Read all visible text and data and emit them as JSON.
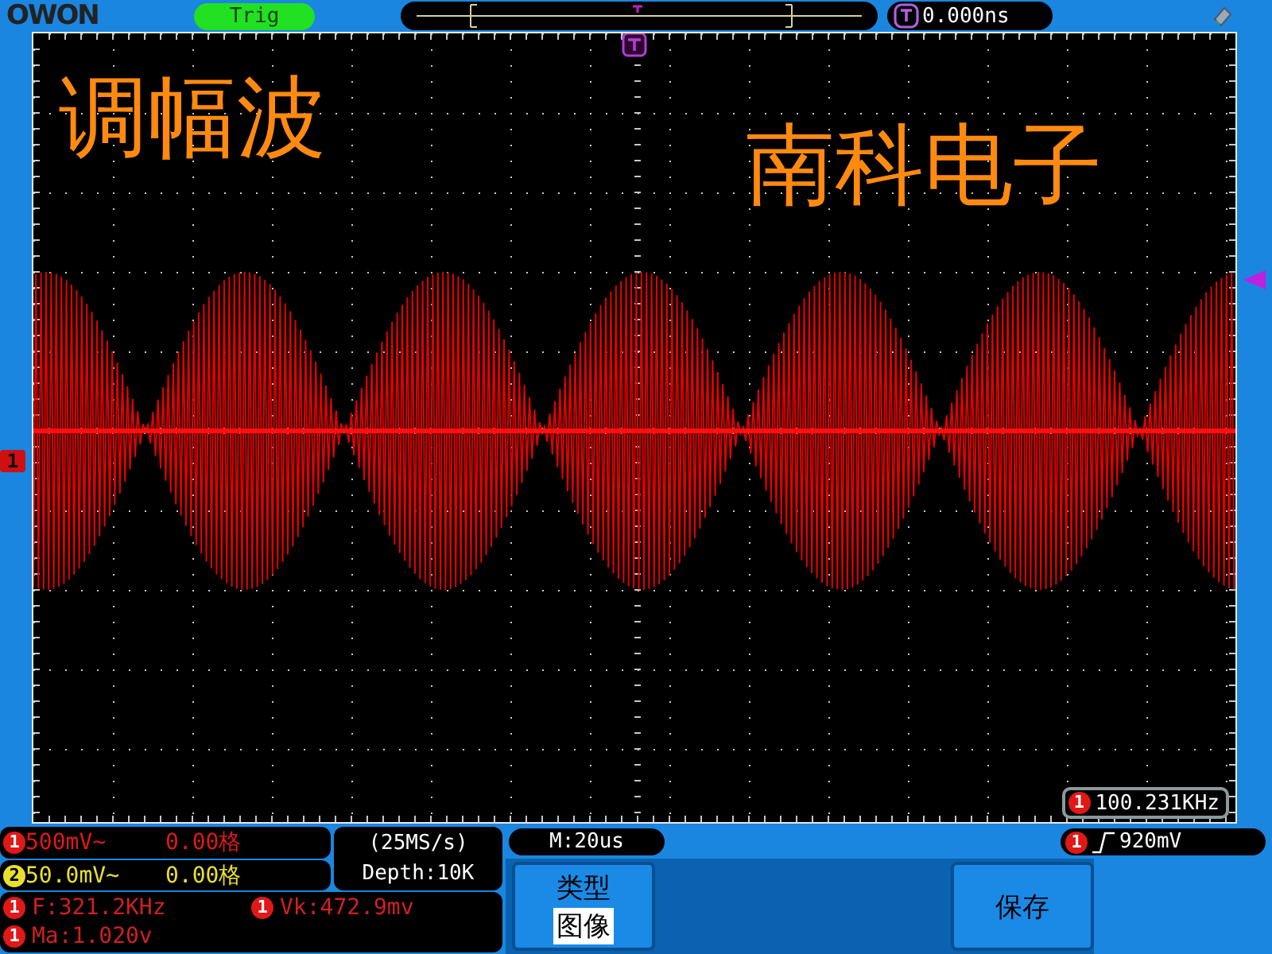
{
  "brand": "OWON",
  "trigger_status": "Trig",
  "trigger_time": "0.000ns",
  "overlay_title": "调幅波",
  "overlay_company": "南科电子",
  "channel_marker": "1",
  "frequency_counter": {
    "channel": "1",
    "value": "100.231KHz"
  },
  "channels": [
    {
      "number": "1",
      "scale": "500mV~",
      "offset": "0.00格",
      "color": "#e01818"
    },
    {
      "number": "2",
      "scale": "50.0mV~",
      "offset": "0.00格",
      "color": "#e8e030"
    }
  ],
  "sampling": {
    "rate": "(25MS/s)",
    "depth": "Depth:10K"
  },
  "measurements": [
    {
      "channel": "1",
      "text": "F:321.2KHz"
    },
    {
      "channel": "1",
      "text": "Vk:472.9mv"
    },
    {
      "channel": "1",
      "text": "Ma:1.020v"
    }
  ],
  "timebase": "M:20us",
  "trigger_level": {
    "channel": "1",
    "value": "920mV"
  },
  "menu": [
    {
      "kind": "option",
      "label": "类型",
      "value": "图像"
    },
    {
      "kind": "action",
      "label": "保存"
    }
  ]
}
